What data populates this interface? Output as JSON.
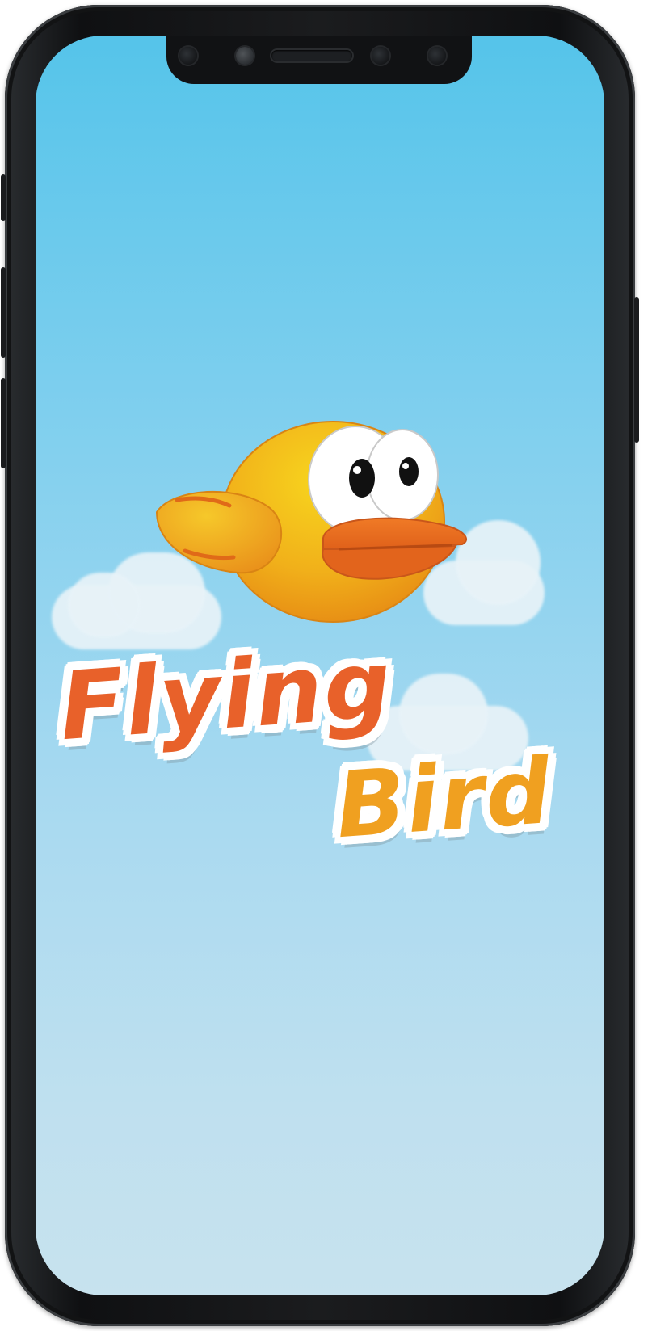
{
  "game": {
    "title_line_1": "Flying",
    "title_line_2": "Bird"
  },
  "colors": {
    "sky_top": "#55c4ea",
    "sky_bottom": "#c7e2ee",
    "bird_body": "#f0b418",
    "bird_beak": "#e8671c",
    "title_orange": "#e8612a",
    "title_yellow": "#f0a020",
    "device_frame": "#121314"
  },
  "icons": {
    "bird": "bird-icon",
    "cloud": "cloud-icon"
  }
}
